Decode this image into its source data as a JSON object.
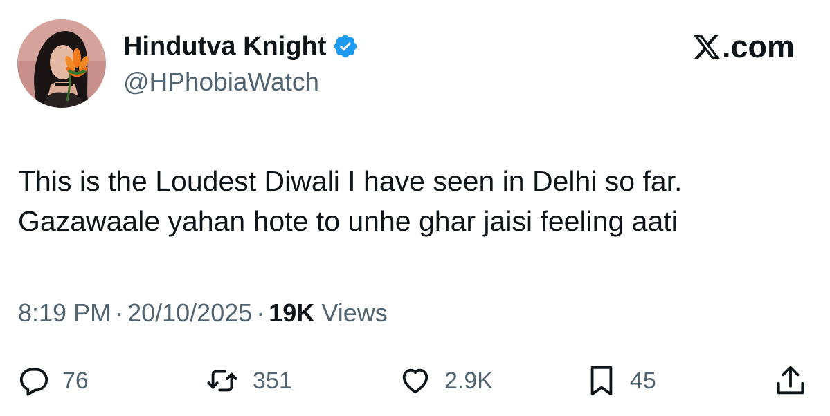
{
  "author": {
    "display_name": "Hindutva Knight",
    "handle": "@HPhobiaWatch",
    "verified": true,
    "verified_color": "#1d9bf0"
  },
  "brand": {
    "text": ".com",
    "icon": "x-logo-icon"
  },
  "tweet": {
    "lines": [
      "This is the Loudest Diwali I have seen in Delhi so far.",
      "Gazawaale yahan hote to unhe ghar jaisi feeling aati"
    ]
  },
  "meta": {
    "time": "8:19 PM",
    "separator": "·",
    "date": "20/10/2025",
    "views_count": "19K",
    "views_label": "Views"
  },
  "actions": {
    "replies": "76",
    "reposts": "351",
    "likes": "2.9K",
    "bookmarks": "45"
  },
  "colors": {
    "text_primary": "#0f1419",
    "text_secondary": "#536471",
    "accent": "#1d9bf0"
  }
}
